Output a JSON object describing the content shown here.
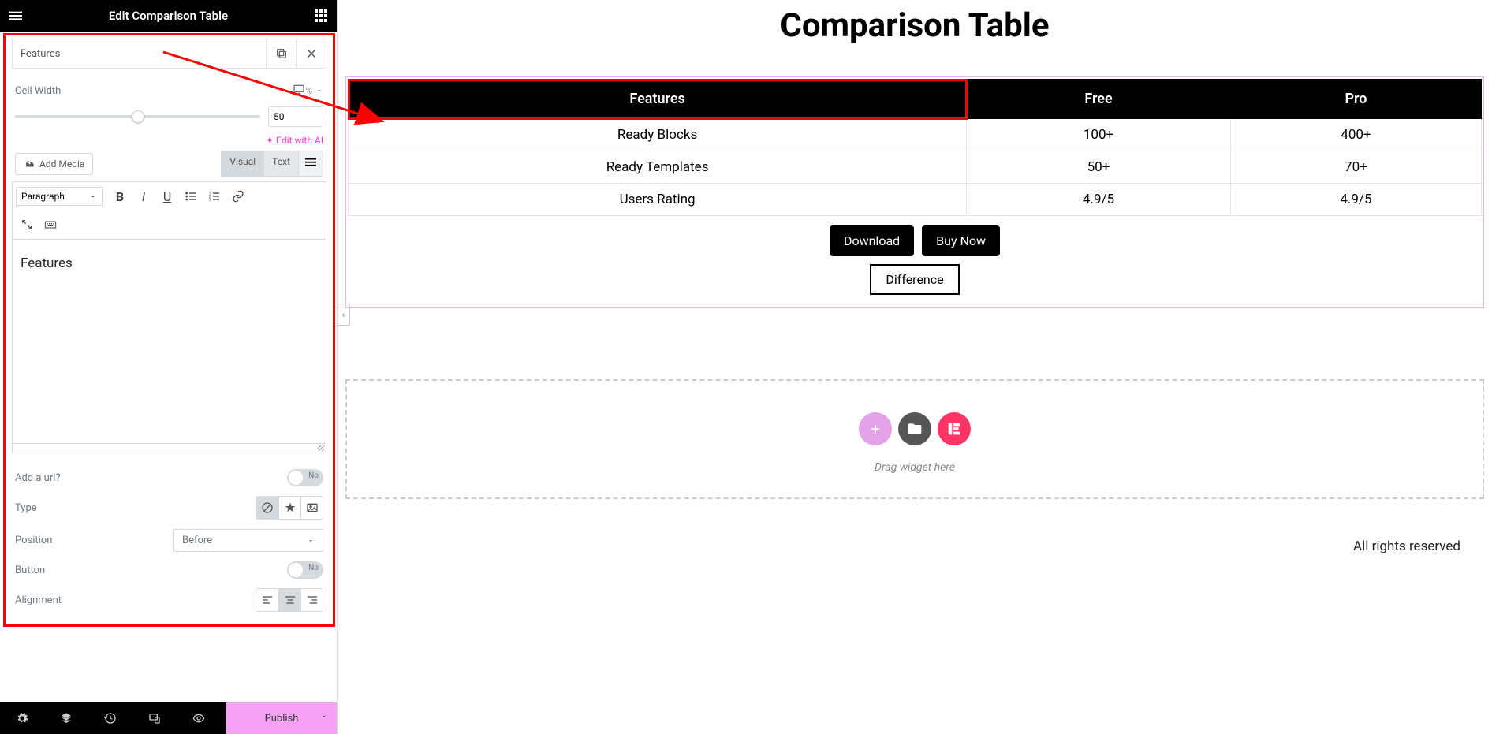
{
  "panel": {
    "title": "Edit Comparison Table",
    "item_title": "Features",
    "cell_width_label": "Cell Width",
    "cell_width_unit": "%",
    "cell_width_value": "50",
    "edit_ai": "Edit with AI",
    "add_media": "Add Media",
    "tab_visual": "Visual",
    "tab_text": "Text",
    "paragraph": "Paragraph",
    "editor_content": "Features",
    "add_url_label": "Add a url?",
    "toggle_no": "No",
    "type_label": "Type",
    "position_label": "Position",
    "position_value": "Before",
    "button_label": "Button",
    "alignment_label": "Alignment",
    "publish": "Publish"
  },
  "canvas": {
    "page_title": "Comparison Table",
    "headers": [
      "Features",
      "Free",
      "Pro"
    ],
    "rows": [
      [
        "Ready Blocks",
        "100+",
        "400+"
      ],
      [
        "Ready Templates",
        "50+",
        "70+"
      ],
      [
        "Users Rating",
        "4.9/5",
        "4.9/5"
      ]
    ],
    "download": "Download",
    "buy_now": "Buy Now",
    "difference": "Difference",
    "drag_text": "Drag widget here",
    "footer": "All rights reserved"
  }
}
